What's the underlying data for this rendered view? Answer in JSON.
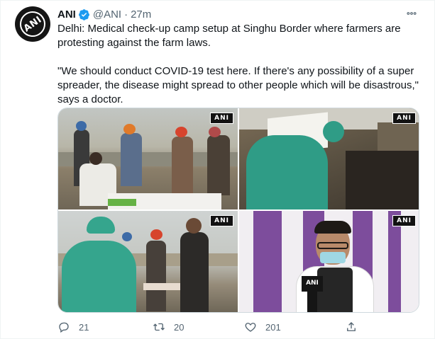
{
  "author": {
    "display_name": "ANI",
    "handle": "@ANI",
    "separator": "·",
    "time": "27m",
    "avatar_text": "ANI"
  },
  "tweet": {
    "line1": "Delhi: Medical check-up camp setup at Singhu Border where farmers are protesting against the farm laws.",
    "line2": "\"We should conduct COVID-19 test here. If there's any possibility of a super spreader, the disease might spread to other people which will be disastrous,\" says a doctor."
  },
  "media": {
    "watermark": "ANI",
    "mic_label": "ANI"
  },
  "actions": {
    "replies": "21",
    "retweets": "20",
    "likes": "201"
  },
  "colors": {
    "text": "#0f1419",
    "secondary": "#536471",
    "verified": "#1d9bf0",
    "border": "#cfd9de"
  },
  "icons": {
    "verified": "verified-badge-icon",
    "more": "more-dots-icon",
    "reply": "reply-icon",
    "retweet": "retweet-icon",
    "like": "heart-icon",
    "share": "share-icon"
  }
}
